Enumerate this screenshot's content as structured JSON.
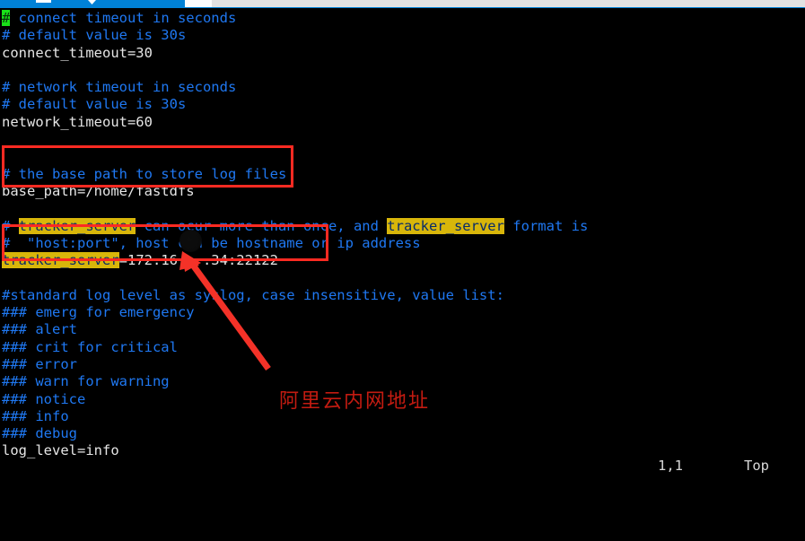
{
  "window": {
    "tab_strip_color": "#0081d6",
    "chrome_color": "#e4e4e4"
  },
  "terminal": {
    "background": "#000000",
    "comment_color": "#1f78f2",
    "value_color": "#e6e6e6",
    "highlight_bg": "#d8b60a",
    "highlight_fg": "#062a6b",
    "cursor_bg": "#19e019"
  },
  "editor": {
    "cursor_char": "#",
    "lines": [
      {
        "id": "l1",
        "segments": [
          {
            "t": "cursor",
            "s": "#"
          },
          {
            "t": "cmt",
            "s": " connect timeout in seconds"
          }
        ]
      },
      {
        "id": "l2",
        "segments": [
          {
            "t": "cmt",
            "s": "# default value is 30s"
          }
        ]
      },
      {
        "id": "l3",
        "segments": [
          {
            "t": "val",
            "s": "connect_timeout=30"
          }
        ]
      },
      {
        "id": "l4",
        "segments": [
          {
            "t": "val",
            "s": ""
          }
        ]
      },
      {
        "id": "l5",
        "segments": [
          {
            "t": "cmt",
            "s": "# network timeout in seconds"
          }
        ]
      },
      {
        "id": "l6",
        "segments": [
          {
            "t": "cmt",
            "s": "# default value is 30s"
          }
        ]
      },
      {
        "id": "l7",
        "segments": [
          {
            "t": "val",
            "s": "network_timeout=60"
          }
        ]
      },
      {
        "id": "l8",
        "segments": [
          {
            "t": "val",
            "s": ""
          }
        ]
      },
      {
        "id": "l9",
        "segments": [
          {
            "t": "val",
            "s": ""
          }
        ]
      },
      {
        "id": "l10",
        "segments": [
          {
            "t": "cmt",
            "s": "# the base path to store log files"
          }
        ]
      },
      {
        "id": "l11",
        "segments": [
          {
            "t": "val",
            "s": "base_path=/home/fastdfs"
          }
        ]
      },
      {
        "id": "l12",
        "segments": [
          {
            "t": "val",
            "s": ""
          }
        ]
      },
      {
        "id": "l13",
        "segments": [
          {
            "t": "cmt",
            "s": "# "
          },
          {
            "t": "hl",
            "s": "tracker_server"
          },
          {
            "t": "cmt",
            "s": " can ocur more than once, and "
          },
          {
            "t": "hl",
            "s": "tracker_server"
          },
          {
            "t": "cmt",
            "s": " format is"
          }
        ]
      },
      {
        "id": "l14",
        "segments": [
          {
            "t": "cmt",
            "s": "#  \"host:port\", host can be hostname or ip address"
          }
        ]
      },
      {
        "id": "l15",
        "segments": [
          {
            "t": "hl",
            "s": "tracker_server"
          },
          {
            "t": "val",
            "s": "=172.16.  .34:22122"
          }
        ]
      },
      {
        "id": "l16",
        "segments": [
          {
            "t": "val",
            "s": ""
          }
        ]
      },
      {
        "id": "l17",
        "segments": [
          {
            "t": "cmt",
            "s": "#standard log level as syslog, case insensitive, value list:"
          }
        ]
      },
      {
        "id": "l18",
        "segments": [
          {
            "t": "cmt",
            "s": "### emerg for emergency"
          }
        ]
      },
      {
        "id": "l19",
        "segments": [
          {
            "t": "cmt",
            "s": "### alert"
          }
        ]
      },
      {
        "id": "l20",
        "segments": [
          {
            "t": "cmt",
            "s": "### crit for critical"
          }
        ]
      },
      {
        "id": "l21",
        "segments": [
          {
            "t": "cmt",
            "s": "### error"
          }
        ]
      },
      {
        "id": "l22",
        "segments": [
          {
            "t": "cmt",
            "s": "### warn for warning"
          }
        ]
      },
      {
        "id": "l23",
        "segments": [
          {
            "t": "cmt",
            "s": "### notice"
          }
        ]
      },
      {
        "id": "l24",
        "segments": [
          {
            "t": "cmt",
            "s": "### info"
          }
        ]
      },
      {
        "id": "l25",
        "segments": [
          {
            "t": "cmt",
            "s": "### debug"
          }
        ]
      },
      {
        "id": "l26",
        "segments": [
          {
            "t": "val",
            "s": "log_level=info"
          }
        ]
      }
    ]
  },
  "statusline": {
    "cursor_position": "1,1",
    "scroll_indicator": "Top"
  },
  "annotations": {
    "zh_note": "阿里云内网地址",
    "zh_note_color": "#c31b11",
    "box_color": "#ff2a22",
    "arrow_color": "#f43228",
    "boxes": [
      {
        "name": "base-path-highlight",
        "target": "base_path=/home/fastdfs"
      },
      {
        "name": "tracker-server-highlight",
        "target": "tracker_server=172.16.*.34:22122"
      }
    ]
  }
}
